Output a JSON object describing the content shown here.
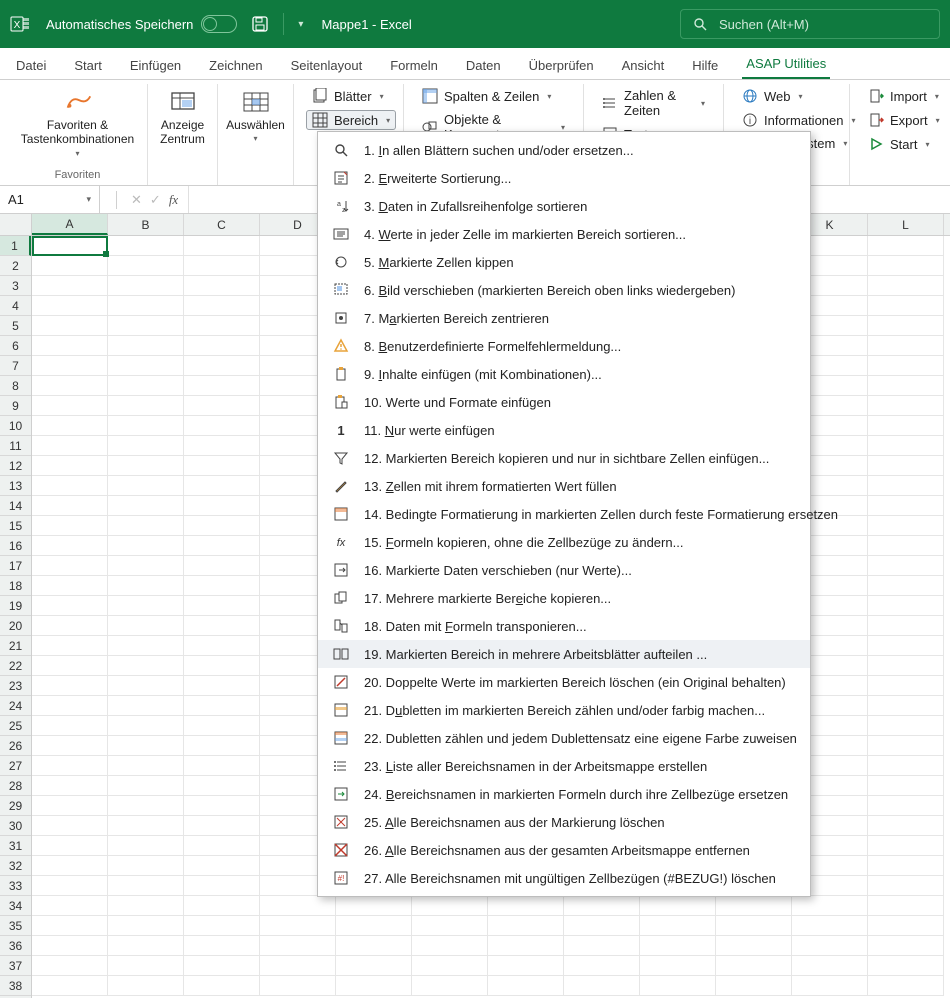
{
  "titlebar": {
    "autosave_label": "Automatisches Speichern",
    "doc_title": "Mappe1  -  Excel",
    "search_placeholder": "Suchen (Alt+M)"
  },
  "tabs": [
    "Datei",
    "Start",
    "Einfügen",
    "Zeichnen",
    "Seitenlayout",
    "Formeln",
    "Daten",
    "Überprüfen",
    "Ansicht",
    "Hilfe",
    "ASAP Utilities"
  ],
  "active_tab_index": 10,
  "ribbon": {
    "favoriten_label": "Favoriten &\nTastenkombinationen",
    "favoriten_group": "Favoriten",
    "anzeige_label": "Anzeige\nZentrum",
    "auswaehlen_label": "Auswählen",
    "blaetter": "Blätter",
    "bereich": "Bereich",
    "spalten": "Spalten & Zeilen",
    "objekte": "Objekte & Kommentare",
    "zahlen": "Zahlen & Zeiten",
    "text": "Text",
    "web": "Web",
    "informationen": "Informationen",
    "system": "System",
    "import": "Import",
    "export": "Export",
    "start": "Start"
  },
  "namebox": "A1",
  "columns": [
    "A",
    "B",
    "C",
    "D",
    "",
    "",
    "",
    "",
    "",
    "",
    "K",
    "L"
  ],
  "rows": 38,
  "menu": {
    "highlight_index": 18,
    "items": [
      {
        "n": "1.",
        "t": "In allen Blättern suchen und/oder ersetzen...",
        "u": 0
      },
      {
        "n": "2.",
        "t": "Erweiterte Sortierung...",
        "u": 0
      },
      {
        "n": "3.",
        "t": "Daten in Zufallsreihenfolge sortieren",
        "u": 0
      },
      {
        "n": "4.",
        "t": "Werte in jeder Zelle im markierten Bereich sortieren...",
        "u": 0
      },
      {
        "n": "5.",
        "t": "Markierte Zellen kippen",
        "u": 0
      },
      {
        "n": "6.",
        "t": "Bild verschieben (markierten Bereich oben links wiedergeben)",
        "u": 0
      },
      {
        "n": "7.",
        "t": "Markierten Bereich zentrieren",
        "u": 1
      },
      {
        "n": "8.",
        "t": "Benutzerdefinierte Formelfehlermeldung...",
        "u": 0
      },
      {
        "n": "9.",
        "t": "Inhalte einfügen (mit Kombinationen)...",
        "u": 0
      },
      {
        "n": "10.",
        "t": "Werte und Formate einfügen",
        "u": -1
      },
      {
        "n": "11.",
        "t": "Nur werte einfügen",
        "u": 0
      },
      {
        "n": "12.",
        "t": "Markierten Bereich kopieren und nur in sichtbare Zellen einfügen...",
        "u": -1
      },
      {
        "n": "13.",
        "t": "Zellen mit ihrem formatierten Wert füllen",
        "u": 0
      },
      {
        "n": "14.",
        "t": "Bedingte Formatierung in markierten Zellen durch feste Formatierung ersetzen",
        "u": -1
      },
      {
        "n": "15.",
        "t": "Formeln kopieren, ohne die Zellbezüge zu ändern...",
        "u": 0
      },
      {
        "n": "16.",
        "t": "Markierte Daten verschieben (nur Werte)...",
        "u": -1
      },
      {
        "n": "17.",
        "t": "Mehrere markierte Bereiche kopieren...",
        "u": 21
      },
      {
        "n": "18.",
        "t": "Daten mit Formeln transponieren...",
        "u": 10
      },
      {
        "n": "19.",
        "t": "Markierten Bereich in mehrere Arbeitsblätter aufteilen ...",
        "u": -1
      },
      {
        "n": "20.",
        "t": "Doppelte Werte im markierten Bereich löschen (ein Original behalten)",
        "u": -1
      },
      {
        "n": "21.",
        "t": "Dubletten im markierten Bereich zählen und/oder farbig machen...",
        "u": 1
      },
      {
        "n": "22.",
        "t": "Dubletten zählen und jedem Dublettensatz eine eigene Farbe zuweisen",
        "u": -1
      },
      {
        "n": "23.",
        "t": "Liste aller Bereichsnamen in der Arbeitsmappe erstellen",
        "u": 0
      },
      {
        "n": "24.",
        "t": "Bereichsnamen in markierten Formeln durch ihre Zellbezüge ersetzen",
        "u": 0
      },
      {
        "n": "25.",
        "t": "Alle Bereichsnamen aus der Markierung löschen",
        "u": 0
      },
      {
        "n": "26.",
        "t": "Alle Bereichsnamen aus der gesamten Arbeitsmappe entfernen",
        "u": 0
      },
      {
        "n": "27.",
        "t": "Alle Bereichsnamen mit ungültigen Zellbezügen (#BEZUG!) löschen",
        "u": -1
      }
    ],
    "icons": [
      "search",
      "sort-ext",
      "az",
      "sort-cell",
      "flip",
      "pic",
      "center",
      "warn",
      "paste",
      "paste2",
      "one",
      "funnel",
      "brush",
      "cond",
      "fx",
      "move",
      "multi",
      "transp",
      "split",
      "dup-del",
      "dup-count",
      "dup-color",
      "list",
      "replace",
      "del-sel",
      "del-all",
      "del-inv"
    ]
  }
}
